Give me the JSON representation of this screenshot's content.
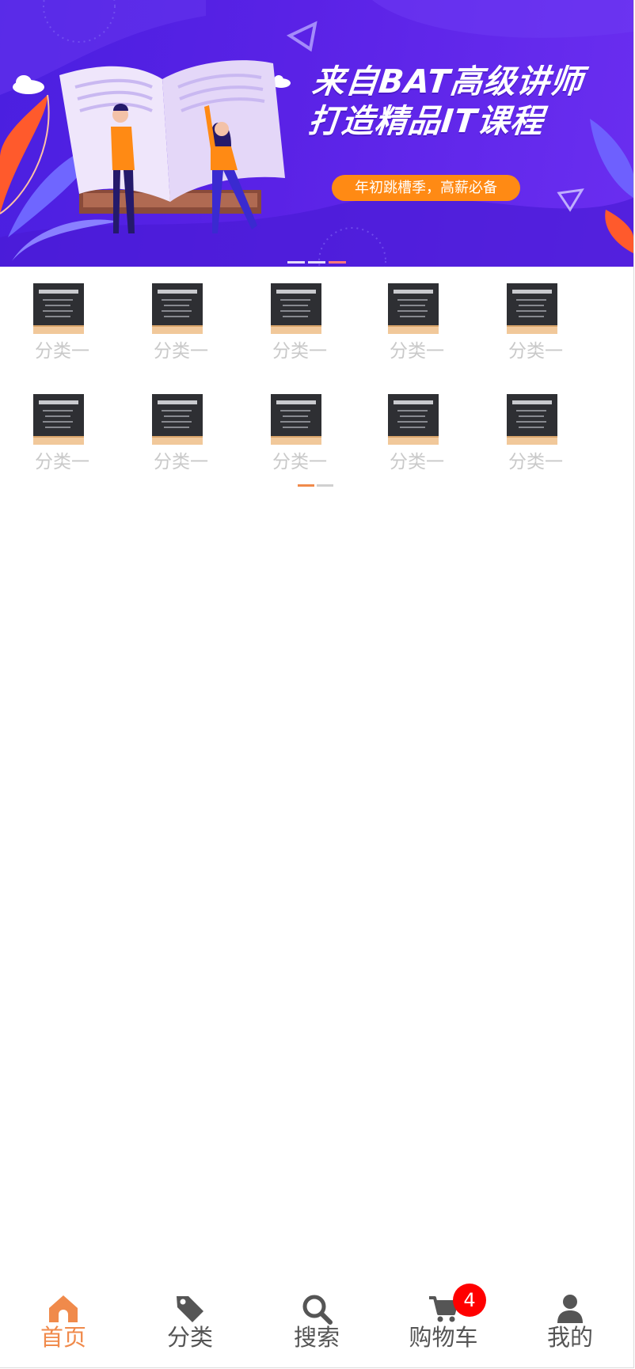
{
  "colors": {
    "accent": "#f08a4b",
    "banner_bg": "#5522e4",
    "banner_pill": "#ff8a14",
    "badge": "#ff0000",
    "tab_inactive": "#555555",
    "category_label": "#c9c9c9"
  },
  "banner": {
    "title_line1": "来自BAT高级讲师",
    "title_line2": "打造精品IT课程",
    "pill_text": "年初跳槽季，高薪必备",
    "dot_count": 3,
    "active_dot": 2
  },
  "categories": {
    "rows": [
      [
        {
          "label": "分类一",
          "icon": "chalkboard-thumbnail"
        },
        {
          "label": "分类一",
          "icon": "chalkboard-thumbnail"
        },
        {
          "label": "分类一",
          "icon": "chalkboard-thumbnail"
        },
        {
          "label": "分类一",
          "icon": "chalkboard-thumbnail"
        },
        {
          "label": "分类一",
          "icon": "chalkboard-thumbnail"
        }
      ],
      [
        {
          "label": "分类一",
          "icon": "chalkboard-thumbnail"
        },
        {
          "label": "分类一",
          "icon": "chalkboard-thumbnail"
        },
        {
          "label": "分类一",
          "icon": "chalkboard-thumbnail"
        },
        {
          "label": "分类一",
          "icon": "chalkboard-thumbnail"
        },
        {
          "label": "分类一",
          "icon": "chalkboard-thumbnail"
        }
      ]
    ],
    "page_count": 2,
    "active_page": 0
  },
  "tabbar": {
    "tabs": [
      {
        "label": "首页",
        "icon": "home-icon",
        "active": true
      },
      {
        "label": "分类",
        "icon": "tag-icon",
        "active": false
      },
      {
        "label": "搜索",
        "icon": "search-icon",
        "active": false
      },
      {
        "label": "购物车",
        "icon": "cart-icon",
        "active": false,
        "badge": "4"
      },
      {
        "label": "我的",
        "icon": "user-icon",
        "active": false
      }
    ]
  }
}
